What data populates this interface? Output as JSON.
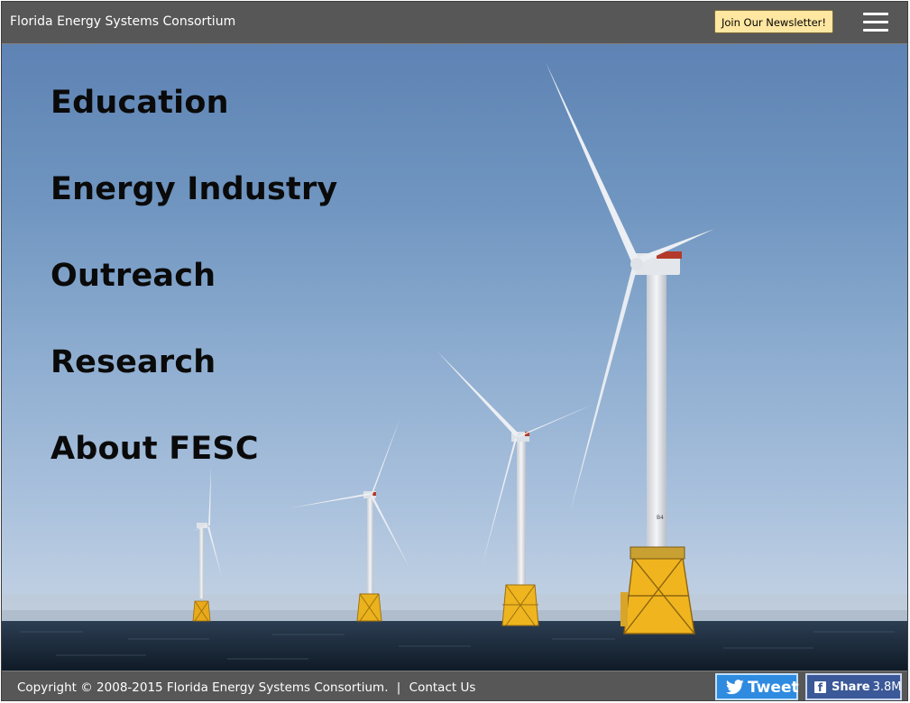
{
  "header": {
    "title": "Florida Energy Systems Consortium",
    "newsletter_label": "Join Our Newsletter!",
    "menu_icon": "hamburger-menu-icon"
  },
  "hero": {
    "image": "offshore-wind-turbines-photo",
    "nav": [
      {
        "label": "Education"
      },
      {
        "label": "Energy Industry"
      },
      {
        "label": "Outreach"
      },
      {
        "label": "Research"
      },
      {
        "label": "About FESC"
      }
    ],
    "turbine_tower_label": "B4"
  },
  "footer": {
    "copyright": "Copyright © 2008-2015 Florida Energy Systems Consortium.",
    "separator": "|",
    "contact_label": "Contact Us",
    "tweet_label": "Tweet",
    "share_label": "Share",
    "share_count": "3.8M"
  },
  "colors": {
    "bar": "#575757",
    "newsletter_bg": "#ffe7a1",
    "tweet_bg": "#2e8be0",
    "facebook_bg": "#3b5998",
    "turbine_base": "#f0b51e"
  }
}
